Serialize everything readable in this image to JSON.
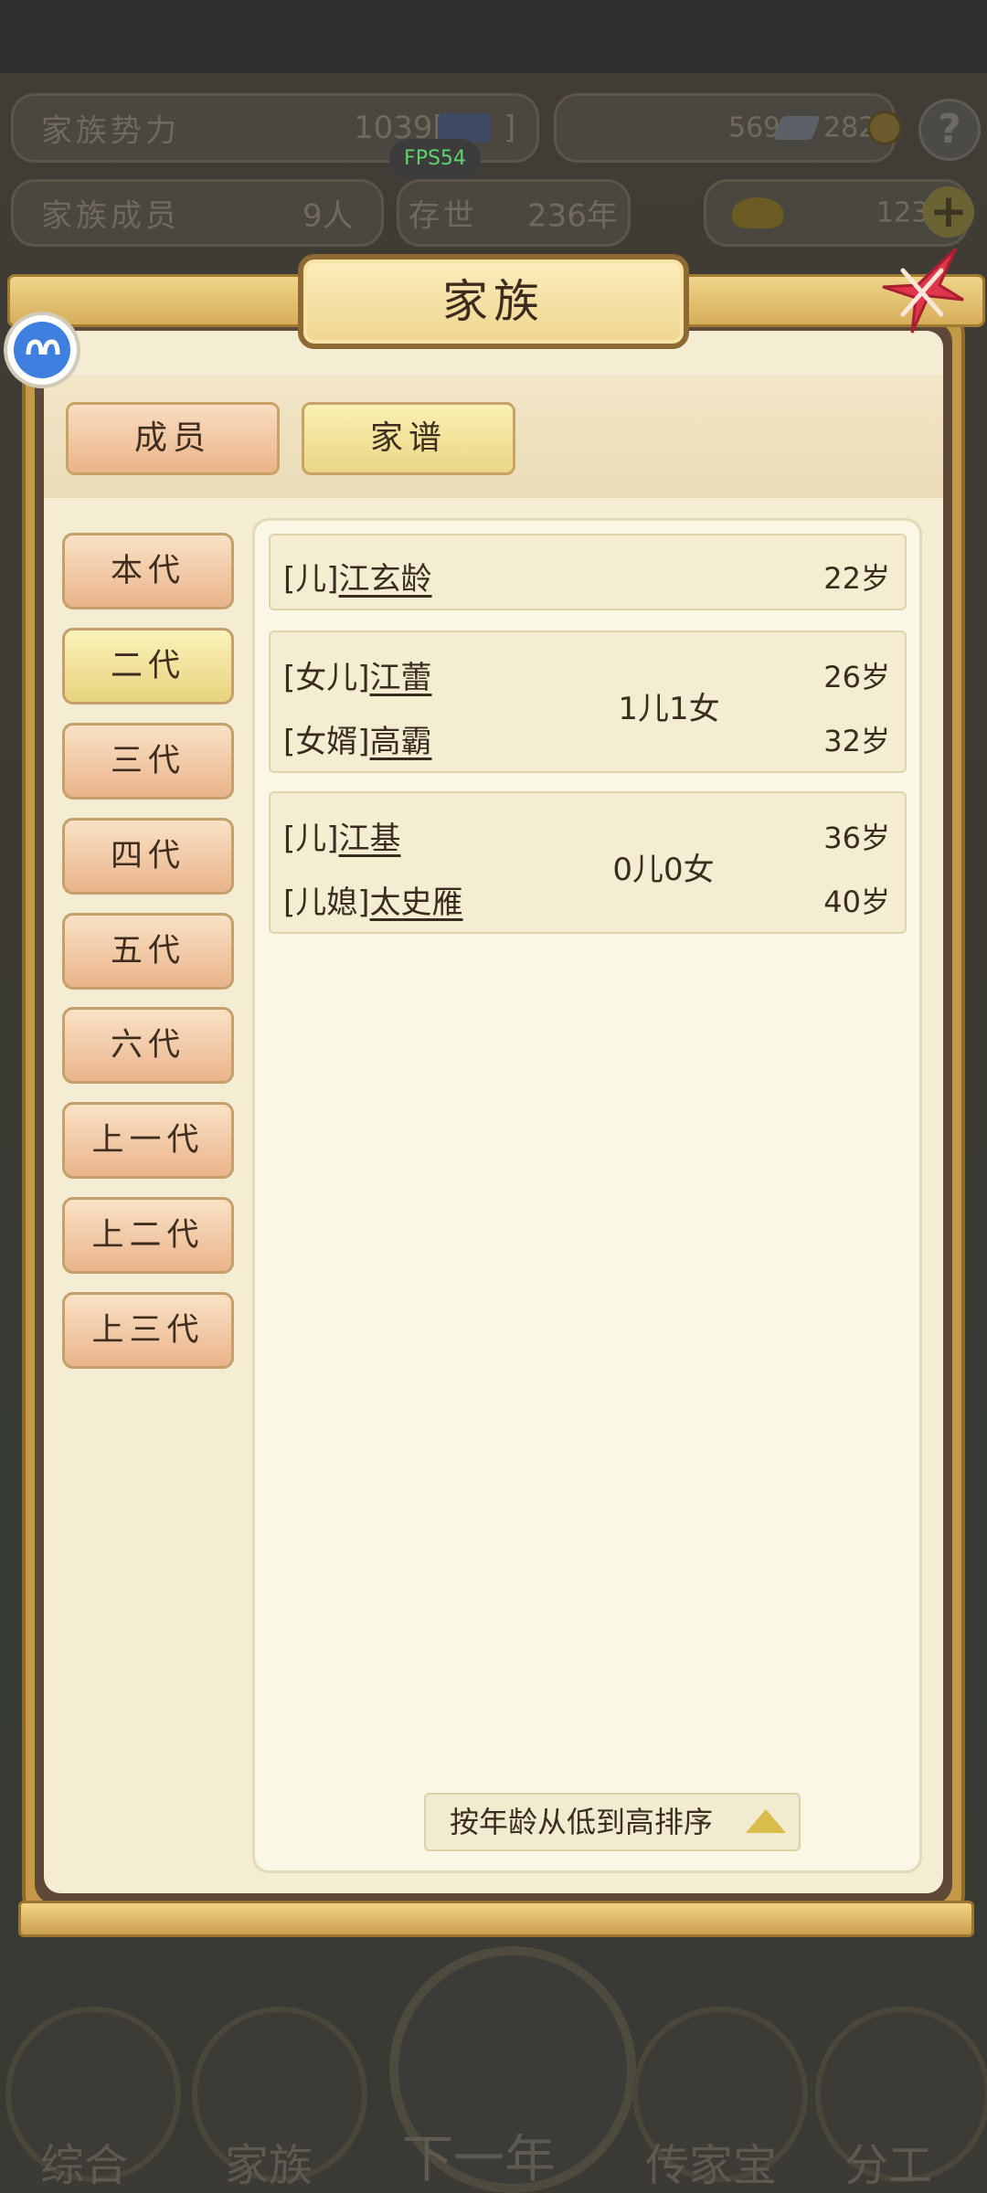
{
  "hud": {
    "power_label": "家族势力",
    "power_value": "1039[",
    "power_rank": "",
    "power_close": "]",
    "fps": "FPS54",
    "silver": "569",
    "coin": "282",
    "help": "?",
    "members_label": "家族成员",
    "members_value": "9人",
    "exist_label": "存世",
    "exist_value": "236年",
    "gold": "123",
    "plus": "+"
  },
  "dialog": {
    "title": "家族",
    "tabs": [
      {
        "label": "成员",
        "active": false
      },
      {
        "label": "家谱",
        "active": true
      }
    ]
  },
  "generations": [
    {
      "label": "本代",
      "active": false
    },
    {
      "label": "二代",
      "active": true
    },
    {
      "label": "三代",
      "active": false
    },
    {
      "label": "四代",
      "active": false
    },
    {
      "label": "五代",
      "active": false
    },
    {
      "label": "六代",
      "active": false
    },
    {
      "label": "上一代",
      "active": false
    },
    {
      "label": "上二代",
      "active": false
    },
    {
      "label": "上三代",
      "active": false
    }
  ],
  "families": [
    {
      "members": [
        {
          "relation": "[儿]",
          "name": "江玄龄",
          "age": "22岁"
        }
      ]
    },
    {
      "children": "1儿1女",
      "members": [
        {
          "relation": "[女儿]",
          "name": "江蕾",
          "age": "26岁"
        },
        {
          "relation": "[女婿]",
          "name": "高霸",
          "age": "32岁"
        }
      ]
    },
    {
      "children": "0儿0女",
      "members": [
        {
          "relation": "[儿]",
          "name": "江基",
          "age": "36岁"
        },
        {
          "relation": "[儿媳]",
          "name": "太史雁",
          "age": "40岁"
        }
      ]
    }
  ],
  "sort": {
    "label": "按年龄从低到高排序"
  },
  "nav": [
    {
      "label": "综合",
      "icon": "scroll-icon"
    },
    {
      "label": "家族",
      "icon": "house-icon"
    },
    {
      "label": "下一年",
      "icon": "mountain-icon"
    },
    {
      "label": "传家宝",
      "icon": "treasure-icon"
    },
    {
      "label": "分工",
      "icon": "person-icon"
    }
  ],
  "colors": {
    "frame_gold": "#c49a48",
    "cream": "#f5ecd4",
    "tab_peach": "#eab48b",
    "tab_yellow": "#e7d37f",
    "fps_green": "#5fd36a"
  }
}
